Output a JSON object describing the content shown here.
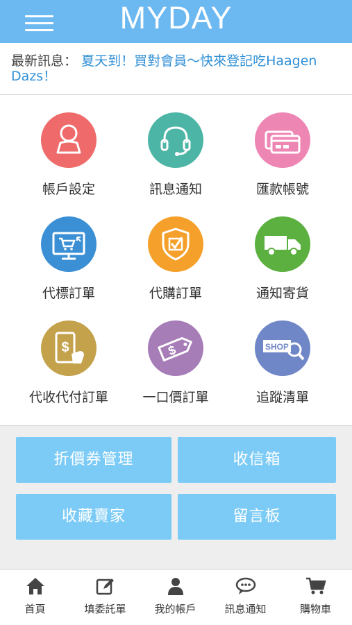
{
  "header": {
    "title": "MYDAY",
    "menu_icon": "hamburger-menu-icon"
  },
  "news": {
    "prefix": "最新訊息：",
    "message": "夏天到！買對會員～快來登記吃Haagen Dazs！"
  },
  "grid": [
    {
      "label": "帳戶設定",
      "icon": "user-icon",
      "color": "#ef6b6b"
    },
    {
      "label": "訊息通知",
      "icon": "headset-icon",
      "color": "#4db5a6"
    },
    {
      "label": "匯款帳號",
      "icon": "credit-card-icon",
      "color": "#ee86b4"
    },
    {
      "label": "代標訂單",
      "icon": "computer-cart-icon",
      "color": "#3b8fd4"
    },
    {
      "label": "代購訂單",
      "icon": "shield-check-icon",
      "color": "#f4a02a"
    },
    {
      "label": "通知寄貨",
      "icon": "truck-icon",
      "color": "#5bb03f"
    },
    {
      "label": "代收代付訂單",
      "icon": "phone-payment-icon",
      "color": "#c4a24c"
    },
    {
      "label": "一口價訂單",
      "icon": "price-tag-icon",
      "color": "#a77db8"
    },
    {
      "label": "追蹤清單",
      "icon": "shop-search-icon",
      "color": "#6f86c7"
    }
  ],
  "buttons": {
    "coupon": "折價券管理",
    "inbox": "收信箱",
    "favorites": "收藏賣家",
    "board": "留言板"
  },
  "tabs": [
    {
      "label": "首頁",
      "icon": "home-icon"
    },
    {
      "label": "填委託單",
      "icon": "edit-icon"
    },
    {
      "label": "我的帳戶",
      "icon": "person-icon"
    },
    {
      "label": "訊息通知",
      "icon": "chat-icon"
    },
    {
      "label": "購物車",
      "icon": "cart-icon"
    }
  ]
}
